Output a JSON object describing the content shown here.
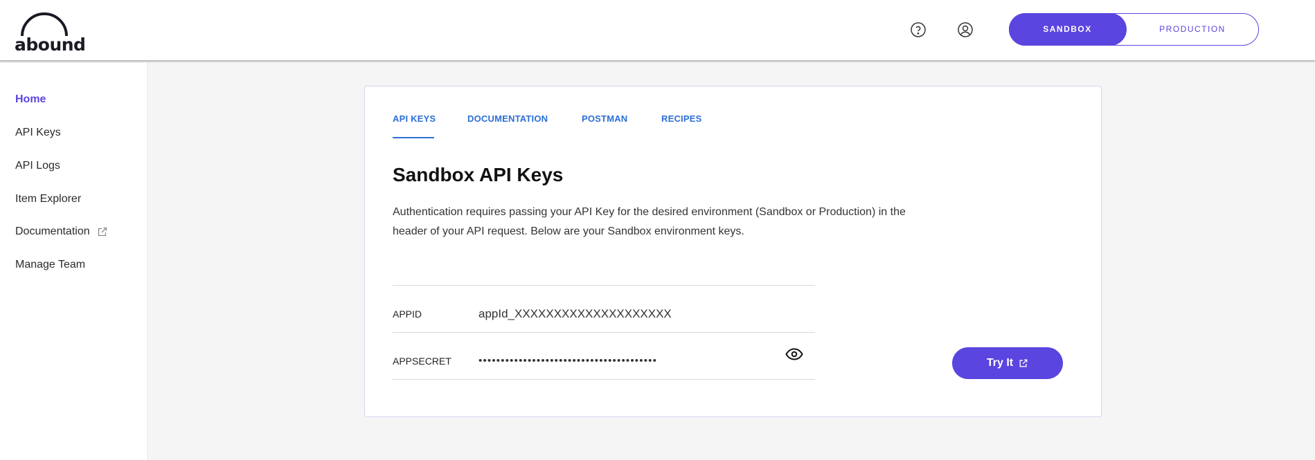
{
  "brand": {
    "name": "abound"
  },
  "header": {
    "environments": {
      "sandbox": "SANDBOX",
      "production": "PRODUCTION",
      "active": "sandbox"
    },
    "icons": [
      "help-circle-icon",
      "user-circle-icon"
    ]
  },
  "sidebar": {
    "items": [
      {
        "label": "Home",
        "active": true
      },
      {
        "label": "API Keys"
      },
      {
        "label": "API Logs"
      },
      {
        "label": "Item Explorer"
      },
      {
        "label": "Documentation",
        "icon": "external-link-icon"
      },
      {
        "label": "Manage Team"
      }
    ]
  },
  "card": {
    "tabs": [
      {
        "label": "API KEYS",
        "active": true
      },
      {
        "label": "DOCUMENTATION"
      },
      {
        "label": "POSTMAN"
      },
      {
        "label": "RECIPES"
      }
    ],
    "title": "Sandbox API Keys",
    "description": "Authentication requires passing your API Key for the desired environment (Sandbox or Production) in the header of your API request. Below are your Sandbox environment keys.",
    "keys": {
      "appid_label": "APPID",
      "appid_value": "appId_XXXXXXXXXXXXXXXXXXXX",
      "appsecret_label": "APPSECRET",
      "appsecret_value": "••••••••••••••••••••••••••••••••••••••••"
    },
    "try_label": "Try It"
  },
  "colors": {
    "accent": "#5b45e0",
    "link": "#2c6fd6",
    "background": "#f5f5f5"
  }
}
